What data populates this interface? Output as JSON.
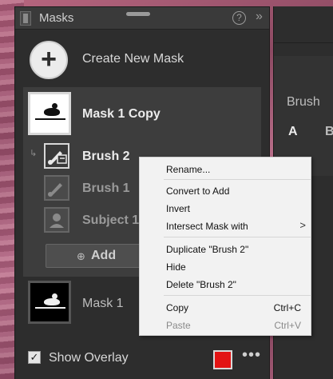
{
  "panel": {
    "title": "Masks",
    "help_icon": "?",
    "collapse_icon": "»",
    "create_new_mask": "Create New Mask",
    "masks": [
      {
        "name": "Mask 1 Copy",
        "components": [
          {
            "name": "Brush 2",
            "active": true
          },
          {
            "name": "Brush 1",
            "active": false
          },
          {
            "name": "Subject 1",
            "active": false
          }
        ]
      },
      {
        "name": "Mask 1"
      }
    ],
    "add_label": "Add",
    "show_overlay": "Show Overlay",
    "overlay_color": "#e31313",
    "more_dots": "•••"
  },
  "right_panel": {
    "brush_label": "Brush",
    "a_label": "A",
    "b_label": "B"
  },
  "context_menu": {
    "items": [
      {
        "label": "Rename...",
        "shortcut": ""
      },
      {
        "label": "Convert to Add",
        "shortcut": ""
      },
      {
        "label": "Invert",
        "shortcut": ""
      },
      {
        "label": "Intersect Mask with",
        "shortcut": ">"
      },
      {
        "label": "Duplicate \"Brush 2\"",
        "shortcut": ""
      },
      {
        "label": "Hide",
        "shortcut": ""
      },
      {
        "label": "Delete \"Brush 2\"",
        "shortcut": ""
      },
      {
        "label": "Copy",
        "shortcut": "Ctrl+C"
      },
      {
        "label": "Paste",
        "shortcut": "Ctrl+V",
        "disabled": true
      }
    ]
  }
}
